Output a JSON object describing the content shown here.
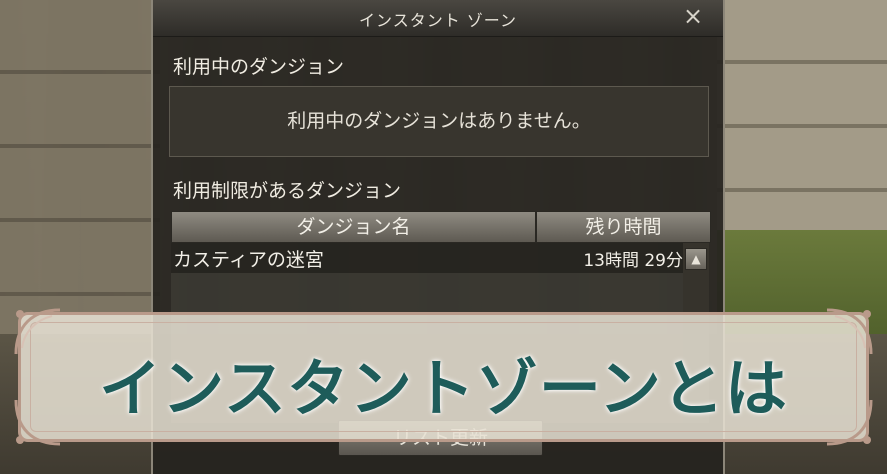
{
  "window": {
    "title": "インスタント ゾーン",
    "close_icon": "×"
  },
  "active_section": {
    "label": "利用中のダンジョン",
    "empty_message": "利用中のダンジョンはありません。"
  },
  "restricted_section": {
    "label": "利用制限があるダンジョン",
    "columns": [
      "ダンジョン名",
      "残り時間"
    ],
    "rows": [
      {
        "name": "カスティアの迷宮",
        "remaining": "13時間 29分"
      }
    ]
  },
  "scroll_up_icon": "▲",
  "refresh_button": "リスト更新",
  "banner": {
    "text": "インスタントゾーンとは",
    "text_color": "#1e5c5a",
    "frame_color": "#b99a8a"
  }
}
